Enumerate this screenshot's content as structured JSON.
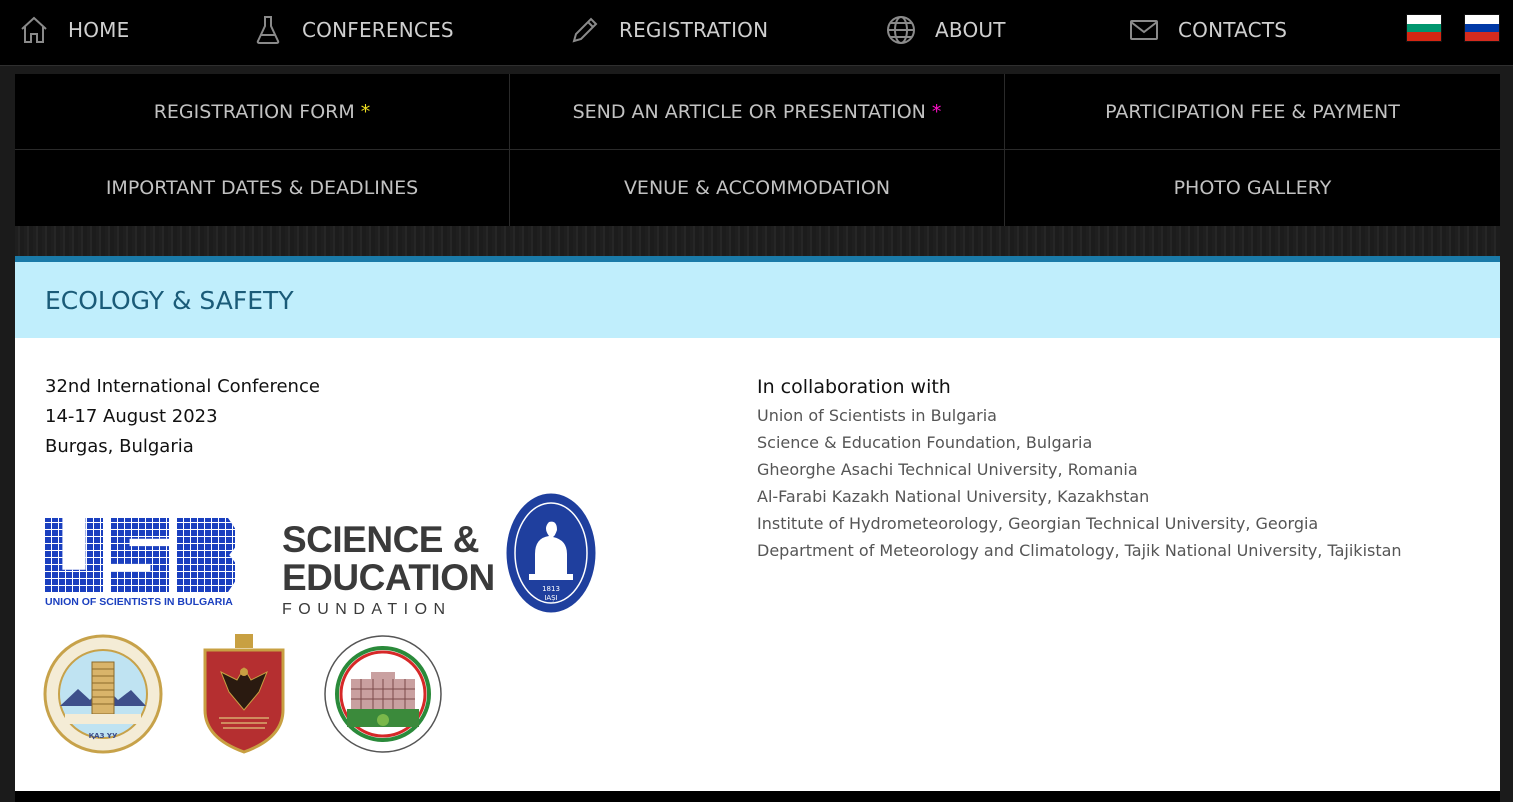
{
  "nav": {
    "items": [
      {
        "label": "HOME",
        "icon": "home-icon"
      },
      {
        "label": "CONFERENCES",
        "icon": "flask-icon"
      },
      {
        "label": "REGISTRATION",
        "icon": "pencil-icon"
      },
      {
        "label": "ABOUT",
        "icon": "globe-icon"
      },
      {
        "label": "CONTACTS",
        "icon": "mail-icon"
      }
    ],
    "languages": [
      {
        "name": "bulgarian-flag",
        "colors": [
          "#ffffff",
          "#00966e",
          "#d62612"
        ]
      },
      {
        "name": "russian-flag",
        "colors": [
          "#ffffff",
          "#0039a6",
          "#d52b1e"
        ]
      }
    ]
  },
  "submenu": {
    "registration_form": "REGISTRATION FORM",
    "send_article": "SEND AN ARTICLE OR PRESENTATION",
    "participation_fee": "PARTICIPATION FEE & PAYMENT",
    "important_dates": "IMPORTANT DATES & DEADLINES",
    "venue": "VENUE & ACCOMMODATION",
    "photo_gallery": "PHOTO GALLERY",
    "required_mark": "*"
  },
  "panel": {
    "title": "ECOLOGY & SAFETY",
    "conference": "32nd International Conference",
    "dates": "14-17 August 2023",
    "location": "Burgas, Bulgaria",
    "collab_title": "In collaboration with",
    "collaborators": [
      "Union of Scientists in Bulgaria",
      "Science & Education Foundation, Bulgaria",
      "Gheorghe Asachi Technical University, Romania",
      "Al-Farabi Kazakh National University, Kazakhstan",
      "Institute of Hydrometeorology, Georgian Technical University, Georgia",
      "Department of Meteorology and Climatology, Tajik National University, Tajikistan"
    ]
  },
  "logos": {
    "usb_caption": "UNION OF SCIENTISTS IN BULGARIA",
    "sef_line1": "SCIENCE &",
    "sef_line2": "EDUCATION",
    "sef_line3": "FOUNDATION",
    "asachi_year": "1813",
    "asachi_city": "IAȘI",
    "kaznu_abbr": "ҚАЗ ҰУ"
  },
  "colors": {
    "accent": "#1a7aa8",
    "header_bg": "#c0eefc",
    "title": "#1a5b78",
    "usb_blue": "#1a3fbf"
  }
}
